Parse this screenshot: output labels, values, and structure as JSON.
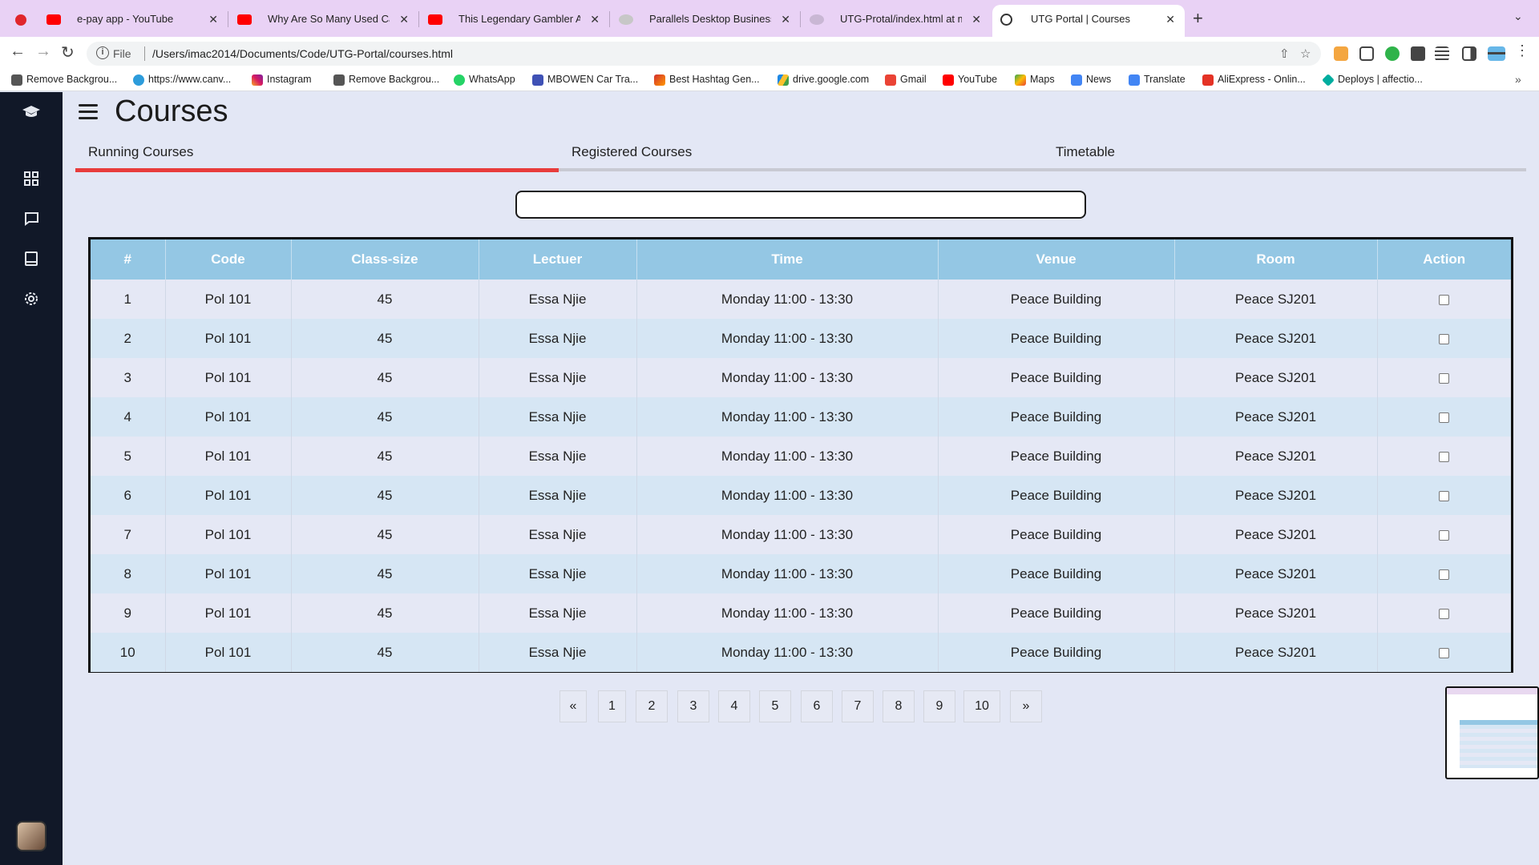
{
  "browser": {
    "tabs": [
      {
        "title": "e-pay app - YouTube",
        "icon": "youtube-icon",
        "active": false
      },
      {
        "title": "Why Are So Many Used Car St",
        "icon": "youtube-icon",
        "active": false
      },
      {
        "title": "This Legendary Gambler Alway",
        "icon": "youtube-icon",
        "active": false
      },
      {
        "title": "Parallels Desktop Business Edi",
        "icon": "apple-icon",
        "active": false
      },
      {
        "title": "UTG-Protal/index.html at main",
        "icon": "github-icon",
        "active": false
      },
      {
        "title": "UTG Portal | Courses",
        "icon": "globe-icon",
        "active": true
      }
    ],
    "close_glyph": "✕",
    "new_tab_glyph": "+",
    "tab_menu_glyph": "⌄",
    "url_scheme": "File",
    "url": "/Users/imac2014/Documents/Code/UTG-Portal/courses.html",
    "bookmarks": [
      {
        "label": "Remove Backgrou...",
        "icon": "removebg-icon"
      },
      {
        "label": "https://www.canv...",
        "icon": "canva-icon"
      },
      {
        "label": "Instagram",
        "icon": "instagram-icon"
      },
      {
        "label": "Remove Backgrou...",
        "icon": "removebg-icon"
      },
      {
        "label": "WhatsApp",
        "icon": "whatsapp-icon"
      },
      {
        "label": "MBOWEN Car Tra...",
        "icon": "mbowen-icon"
      },
      {
        "label": "Best Hashtag Gen...",
        "icon": "hashtag-icon"
      },
      {
        "label": "drive.google.com",
        "icon": "drive-icon"
      },
      {
        "label": "Gmail",
        "icon": "gmail-icon"
      },
      {
        "label": "YouTube",
        "icon": "youtube-icon"
      },
      {
        "label": "Maps",
        "icon": "maps-icon"
      },
      {
        "label": "News",
        "icon": "news-icon"
      },
      {
        "label": "Translate",
        "icon": "translate-icon"
      },
      {
        "label": "AliExpress - Onlin...",
        "icon": "aliexpress-icon"
      },
      {
        "label": "Deploys | affectio...",
        "icon": "netlify-icon"
      }
    ],
    "bookmarks_more": "»"
  },
  "sidebar": {
    "items": [
      {
        "icon": "graduation-cap-icon"
      },
      {
        "icon": "dashboard-grid-icon"
      },
      {
        "icon": "messages-icon"
      },
      {
        "icon": "book-icon"
      },
      {
        "icon": "settings-gear-icon"
      }
    ]
  },
  "page": {
    "title": "Courses",
    "tabs": [
      "Running Courses",
      "Registered Courses",
      "Timetable"
    ],
    "active_tab": 0,
    "search_value": "",
    "search_placeholder": ""
  },
  "table": {
    "headers": [
      "#",
      "Code",
      "Class-size",
      "Lectuer",
      "Time",
      "Venue",
      "Room",
      "Action"
    ],
    "rows": [
      [
        "1",
        "Pol 101",
        "45",
        "Essa Njie",
        "Monday 11:00 - 13:30",
        "Peace Building",
        "Peace SJ201"
      ],
      [
        "2",
        "Pol 101",
        "45",
        "Essa Njie",
        "Monday 11:00 - 13:30",
        "Peace Building",
        "Peace SJ201"
      ],
      [
        "3",
        "Pol 101",
        "45",
        "Essa Njie",
        "Monday 11:00 - 13:30",
        "Peace Building",
        "Peace SJ201"
      ],
      [
        "4",
        "Pol 101",
        "45",
        "Essa Njie",
        "Monday 11:00 - 13:30",
        "Peace Building",
        "Peace SJ201"
      ],
      [
        "5",
        "Pol 101",
        "45",
        "Essa Njie",
        "Monday 11:00 - 13:30",
        "Peace Building",
        "Peace SJ201"
      ],
      [
        "6",
        "Pol 101",
        "45",
        "Essa Njie",
        "Monday 11:00 - 13:30",
        "Peace Building",
        "Peace SJ201"
      ],
      [
        "7",
        "Pol 101",
        "45",
        "Essa Njie",
        "Monday 11:00 - 13:30",
        "Peace Building",
        "Peace SJ201"
      ],
      [
        "8",
        "Pol 101",
        "45",
        "Essa Njie",
        "Monday 11:00 - 13:30",
        "Peace Building",
        "Peace SJ201"
      ],
      [
        "9",
        "Pol 101",
        "45",
        "Essa Njie",
        "Monday 11:00 - 13:30",
        "Peace Building",
        "Peace SJ201"
      ],
      [
        "10",
        "Pol 101",
        "45",
        "Essa Njie",
        "Monday 11:00 - 13:30",
        "Peace Building",
        "Peace SJ201"
      ]
    ]
  },
  "pagination": {
    "prev": "«",
    "pages": [
      "1",
      "2",
      "3",
      "4",
      "5",
      "6",
      "7",
      "8",
      "9",
      "10"
    ],
    "next": "»"
  },
  "colors": {
    "sidebar_bg": "#111828",
    "page_bg": "#e3e7f5",
    "header_bg": "#94c7e4",
    "active_tab_accent": "#e83c3c",
    "row_odd": "#e5e8f5",
    "row_even": "#d6e6f4",
    "tabstrip_bg": "#e9d2f5"
  }
}
